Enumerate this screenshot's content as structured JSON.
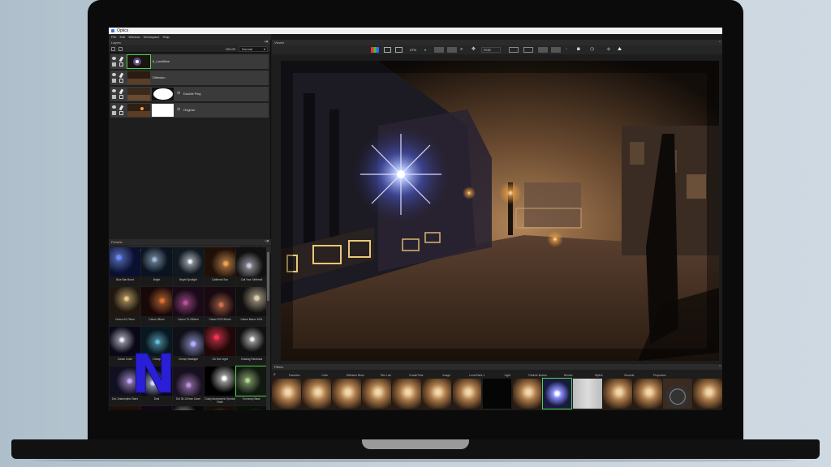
{
  "window": {
    "title": "Optics",
    "menu": [
      "File",
      "Edit",
      "Window",
      "Workspace",
      "Help"
    ]
  },
  "layers_panel": {
    "title": "Layers",
    "opacity": "100.00",
    "blend_mode": "Normal",
    "layers": [
      {
        "name": "6_Landflare",
        "selected": true,
        "has_mask": false
      },
      {
        "name": "Diffusion",
        "selected": false,
        "has_mask": false
      },
      {
        "name": "Double Play",
        "selected": false,
        "has_mask": true
      },
      {
        "name": "Original",
        "selected": false,
        "has_mask": true
      }
    ]
  },
  "presets_panel": {
    "title": "Presets",
    "filter_value": "All",
    "search_placeholder": "Search",
    "items": [
      {
        "label": "Blue Star Burst"
      },
      {
        "label": "Bright"
      },
      {
        "label": "Bright Spotlight"
      },
      {
        "label": "California Sun"
      },
      {
        "label": "Call Your Girlfriend"
      },
      {
        "label": "Canon 24-70mm"
      },
      {
        "label": "Canon 28mm"
      },
      {
        "label": "Canon 70-200mm"
      },
      {
        "label": "Canon EOS 50mm"
      },
      {
        "label": "Canon Macro 100L"
      },
      {
        "label": "Canon Zoom"
      },
      {
        "label": "Cheap"
      },
      {
        "label": "Cheap Headlight"
      },
      {
        "label": "Cin Noir Light"
      },
      {
        "label": "Chasing Rainbows"
      },
      {
        "label": "Dot, Anamorphic Stars"
      },
      {
        "label": "Dots"
      },
      {
        "label": "Dot 35-100mm Zoom"
      },
      {
        "label": "Dusty Anamorphic Special Flare"
      },
      {
        "label": "Economy Base"
      },
      {
        "label": ""
      },
      {
        "label": ""
      },
      {
        "label": ""
      },
      {
        "label": ""
      },
      {
        "label": ""
      }
    ]
  },
  "viewer": {
    "title": "Viewer",
    "zoom": "37%",
    "channel": "RGB"
  },
  "filters_panel": {
    "title": "Filters",
    "categories": [
      "Favorites",
      "Color",
      "Diffusion Blurs",
      "Film Lab",
      "Grads/Tints",
      "Image",
      "Lens/Stars 1",
      "Light",
      "Particle Illusion",
      "Render",
      "Stylize",
      "Sunsets",
      "Proportion"
    ]
  },
  "colors": {
    "accent_selection": "#4fd14f",
    "panel_bg": "#1e1e1e",
    "logo_fill": "#2a1fd8"
  },
  "icons": [
    "eye-icon",
    "lock-icon",
    "brush-icon",
    "mask-icon",
    "search-icon",
    "camera-icon",
    "hand-icon",
    "zoom-icon",
    "star-icon",
    "close-icon",
    "undock-icon"
  ],
  "overlay": {
    "logo_letter": "N"
  }
}
